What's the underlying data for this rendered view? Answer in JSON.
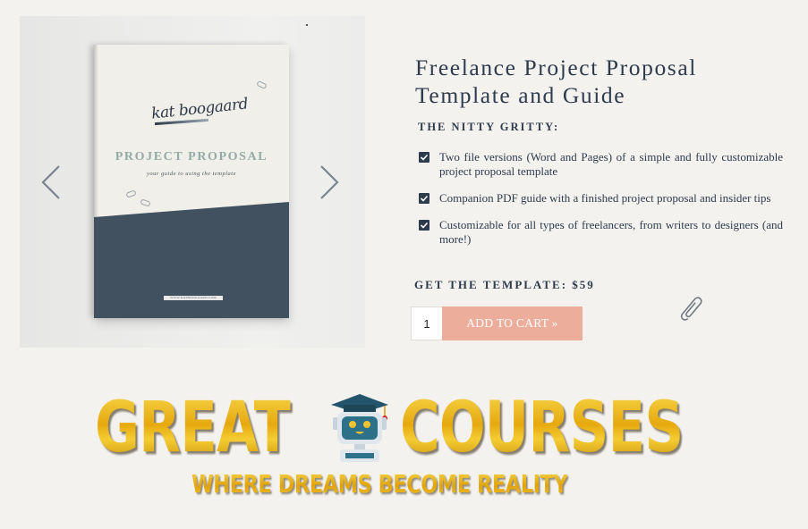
{
  "gallery": {
    "cover": {
      "signature": "kat boogaard",
      "title": "PROJECT PROPOSAL",
      "subtitle": "your guide to using the template",
      "url": "WWW.KATBOOGAARD.COM"
    },
    "prev_icon": "chevron-left-icon",
    "next_icon": "chevron-right-icon"
  },
  "product": {
    "title": "Freelance Project Proposal Template and Guide",
    "section_label": "THE NITTY GRITTY:",
    "features": [
      {
        "text": "Two file versions (Word and Pages) of a simple and fully customizable project proposal template",
        "checked": true
      },
      {
        "text": "Companion PDF guide with a finished project proposal and insider tips",
        "checked": true
      },
      {
        "text": "Customizable for all types of freelancers, from writers to designers (and more!)",
        "checked": true
      }
    ],
    "price_label": "GET THE TEMPLATE: $59",
    "quantity": "1",
    "add_to_cart_label": "ADD TO CART »",
    "decor_icon": "paperclip-icon"
  },
  "watermark": {
    "word1": "GREAT",
    "word2": "COURSES",
    "tagline": "WHERE DREAMS BECOME REALITY",
    "icon": "robot-graduate-icon"
  },
  "colors": {
    "background": "#f4f2ee",
    "text_navy": "#2d3b4c",
    "button_salmon": "#ecad9b",
    "cover_dark": "#425160",
    "logo_gold": "#e8b418"
  }
}
